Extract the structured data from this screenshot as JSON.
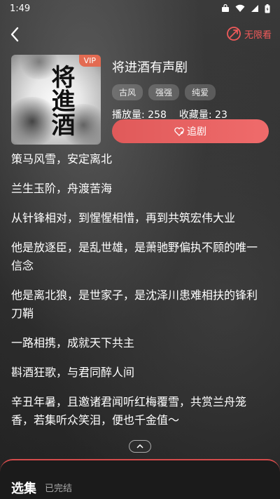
{
  "status_bar": {
    "time": "1:49"
  },
  "nav": {
    "unlimited_label": "无限看"
  },
  "drama": {
    "vip_badge": "VIP",
    "cover_title": "将進酒",
    "title": "将进酒有声剧",
    "tags": [
      "古风",
      "强强",
      "纯爱"
    ],
    "play_count_label": "播放量: 258",
    "fav_count_label": "收藏量: 23",
    "follow_label": "追剧"
  },
  "description": [
    "策马风雪，安定离北",
    "兰生玉阶，舟渡苦海",
    "从针锋相对，到惺惺相惜，再到共筑宏伟大业",
    "他是放逐臣，是乱世雄，是萧驰野偏执不顾的唯一信念",
    "他是离北狼，是世家子，是沈泽川患难相扶的锋利刀鞘",
    "一路相携，成就天下共主",
    "斟酒狂歌，与君同醉人间",
    "辛丑年暑，且邀诸君闻听红梅覆雪，共赏兰舟笼香，若集听众笑泪，便也千金值～"
  ],
  "episodes": {
    "title": "选集",
    "status": "已完结"
  },
  "colors": {
    "accent": "#ef6b6b"
  }
}
